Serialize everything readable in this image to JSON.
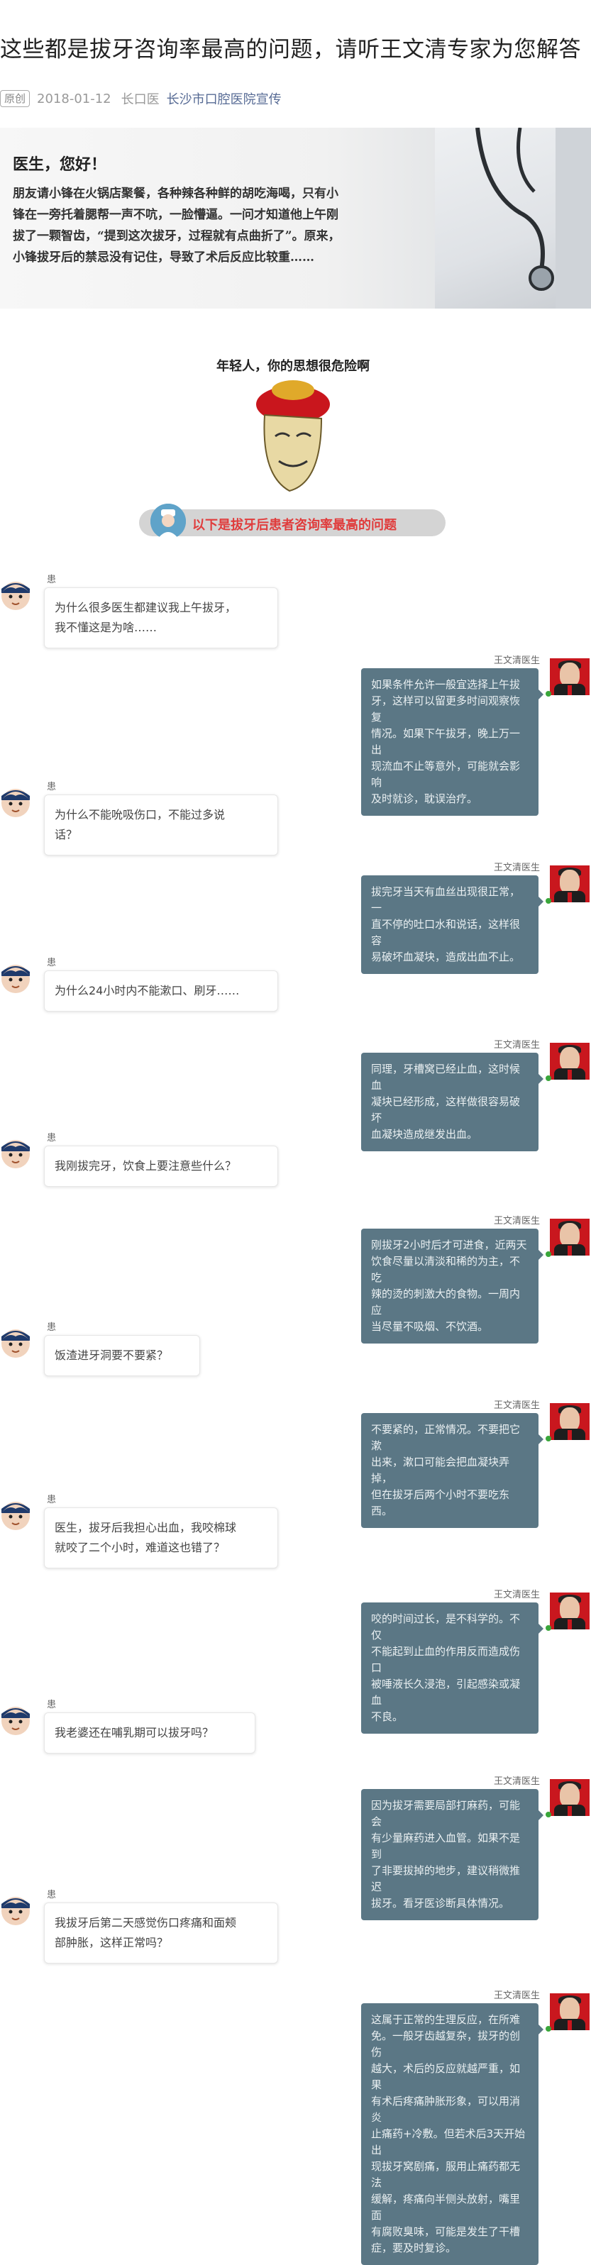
{
  "article": {
    "title": "这些都是拔牙咨询率最高的问题，请听王文清专家为您解答",
    "tag": "原创",
    "date": "2018-01-12",
    "author": "长口医",
    "account": "长沙市口腔医院宣传"
  },
  "banner": {
    "greeting": "医生，您好！",
    "lines": [
      "朋友请小锋在火锅店聚餐，各种辣各种鲜的胡吃海喝，只有小",
      "锋在一旁托着腮帮一声不吭，一脸懵逼。一问才知道他上午刚",
      "拔了一颗智齿，“提到这次拔牙，过程就有点曲折了”。原来，",
      "小锋拔牙后的禁忌没有记住，导致了术后反应比较重……"
    ]
  },
  "meme": {
    "caption": "年轻人，你的思想很危险啊"
  },
  "section_header": "以下是拔牙后患者咨询率最高的问题",
  "labels": {
    "patient": "患者",
    "doctor": "王文清医生"
  },
  "qa": [
    {
      "q": [
        "为什么很多医生都建议我上午拔牙，",
        "我不懂这是为啥……"
      ],
      "a": [
        "如果条件允许一般宜选择上午拔",
        "牙，这样可以留更多时间观察恢复",
        "情况。如果下午拔牙，晚上万一出",
        "现流血不止等意外，可能就会影响",
        "及时就诊，耽误治疗。"
      ]
    },
    {
      "q": [
        "为什么不能吮吸伤口，不能过多说",
        "话？"
      ],
      "a": [
        "拔完牙当天有血丝出现很正常，一",
        "直不停的吐口水和说话，这样很容",
        "易破坏血凝块，造成出血不止。"
      ]
    },
    {
      "q": [
        "为什么24小时内不能漱口、刷牙……"
      ],
      "a": [
        "同理，牙槽窝已经止血，这时候血",
        "凝块已经形成，这样做很容易破坏",
        "血凝块造成继发出血。"
      ]
    },
    {
      "q": [
        "我刚拔完牙，饮食上要注意些什么？"
      ],
      "a": [
        "刚拔牙2小时后才可进食，近两天",
        "饮食尽量以清淡和稀的为主，不吃",
        "辣的烫的刺激大的食物。一周内应",
        "当尽量不吸烟、不饮酒。"
      ]
    },
    {
      "q": [
        "饭渣进牙洞要不要紧？"
      ],
      "a": [
        "不要紧的，正常情况。不要把它漱",
        "出来，漱口可能会把血凝块弄掉，",
        "但在拔牙后两个小时不要吃东西。"
      ]
    },
    {
      "q": [
        "医生，拔牙后我担心出血，我咬棉球",
        "就咬了二个小时，难道这也错了？"
      ],
      "a": [
        "咬的时间过长，是不科学的。不仅",
        "不能起到止血的作用反而造成伤口",
        "被唾液长久浸泡，引起感染或凝血",
        "不良。"
      ]
    },
    {
      "q": [
        "我老婆还在哺乳期可以拔牙吗？"
      ],
      "a": [
        "因为拔牙需要局部打麻药，可能会",
        "有少量麻药进入血管。如果不是到",
        "了非要拔掉的地步，建议稍微推迟",
        "拔牙。看牙医诊断具体情况。"
      ]
    },
    {
      "q": [
        "我拔牙后第二天感觉伤口疼痛和面颊",
        "部肿胀，这样正常吗？"
      ],
      "a": [
        "这属于正常的生理反应，在所难",
        "免。一般牙齿越复杂，拔牙的创伤",
        "越大，术后的反应就越严重，如果",
        "有术后疼痛肿胀形象，可以用消炎",
        "止痛药+冷敷。但若术后3天开始出",
        "现拔牙窝剧痛，服用止痛药都无法",
        "缓解，疼痛向半侧头放射，嘴里面",
        "有腐败臭味，可能是发生了干槽",
        "症，要及时复诊。"
      ]
    }
  ]
}
